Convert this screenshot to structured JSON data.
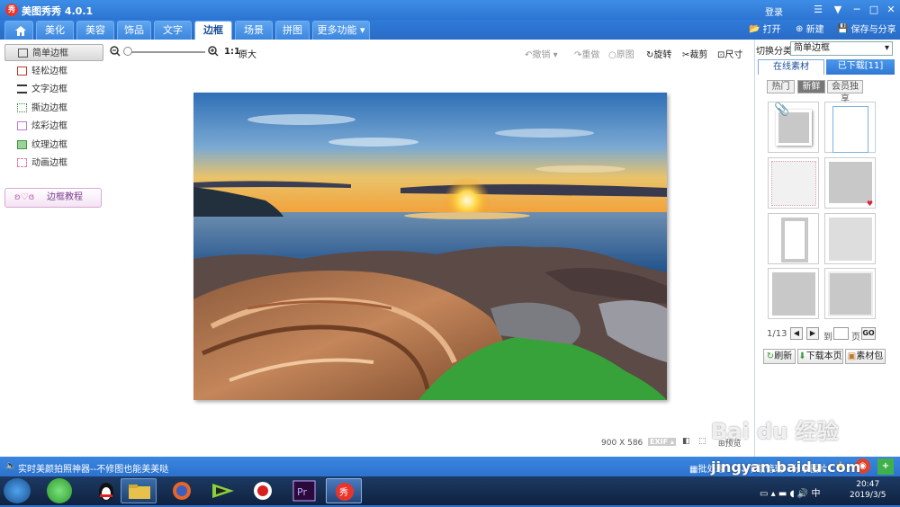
{
  "app": {
    "title": "美图秀秀 4.0.1",
    "logo": "秀",
    "login": "登录"
  },
  "window_controls": [
    "─",
    "□",
    "✕"
  ],
  "tabs": [
    "美化",
    "美容",
    "饰品",
    "文字",
    "边框",
    "场景",
    "拼图",
    "更多功能"
  ],
  "active_tab": "边框",
  "top_actions": {
    "open": "打开",
    "new": "新建",
    "save_share": "保存与分享"
  },
  "left_panel": {
    "items": [
      "简单边框",
      "轻松边框",
      "文字边框",
      "撕边边框",
      "炫彩边框",
      "纹理边框",
      "动画边框"
    ],
    "active": "简单边框",
    "tutorial": "边框教程"
  },
  "toolbar": {
    "ratio": "1:1",
    "original": "原大",
    "undo": "撤销",
    "redo": "重做",
    "original_img": "原图",
    "rotate": "旋转",
    "crop": "裁剪",
    "size": "尺寸"
  },
  "image_info": {
    "width": "900",
    "x": "X",
    "height": "586",
    "exif": "EXIF",
    "preview": "预览"
  },
  "right_panel": {
    "category_label": "切换分类",
    "category_value": "简单边框",
    "tabs": [
      "在线素材",
      "已下载[11]"
    ],
    "subtabs": [
      "热门",
      "新鲜",
      "会员独享"
    ],
    "active_subtab": "新鲜",
    "page_current": "1/13",
    "goto_label": "到",
    "page_label": "页",
    "go": "GO",
    "refresh": "刷新",
    "download_page": "下载本页",
    "material_pack": "素材包"
  },
  "statusbar": {
    "promo": "实时美颜拍照神器--不修图也能美美哒",
    "batch": "批处理",
    "download_mgr": "下载管理",
    "share_img": "分享图片"
  },
  "clock": {
    "time": "20:47",
    "date": "2019/3/5"
  },
  "watermark": {
    "text": "Bai du 经验",
    "url": "jingyan.baidu.com"
  },
  "colors": {
    "title_bar": "#2d74d2",
    "tab_active_text": "#1a4f9c",
    "accent_pink": "#d9a6d6"
  }
}
